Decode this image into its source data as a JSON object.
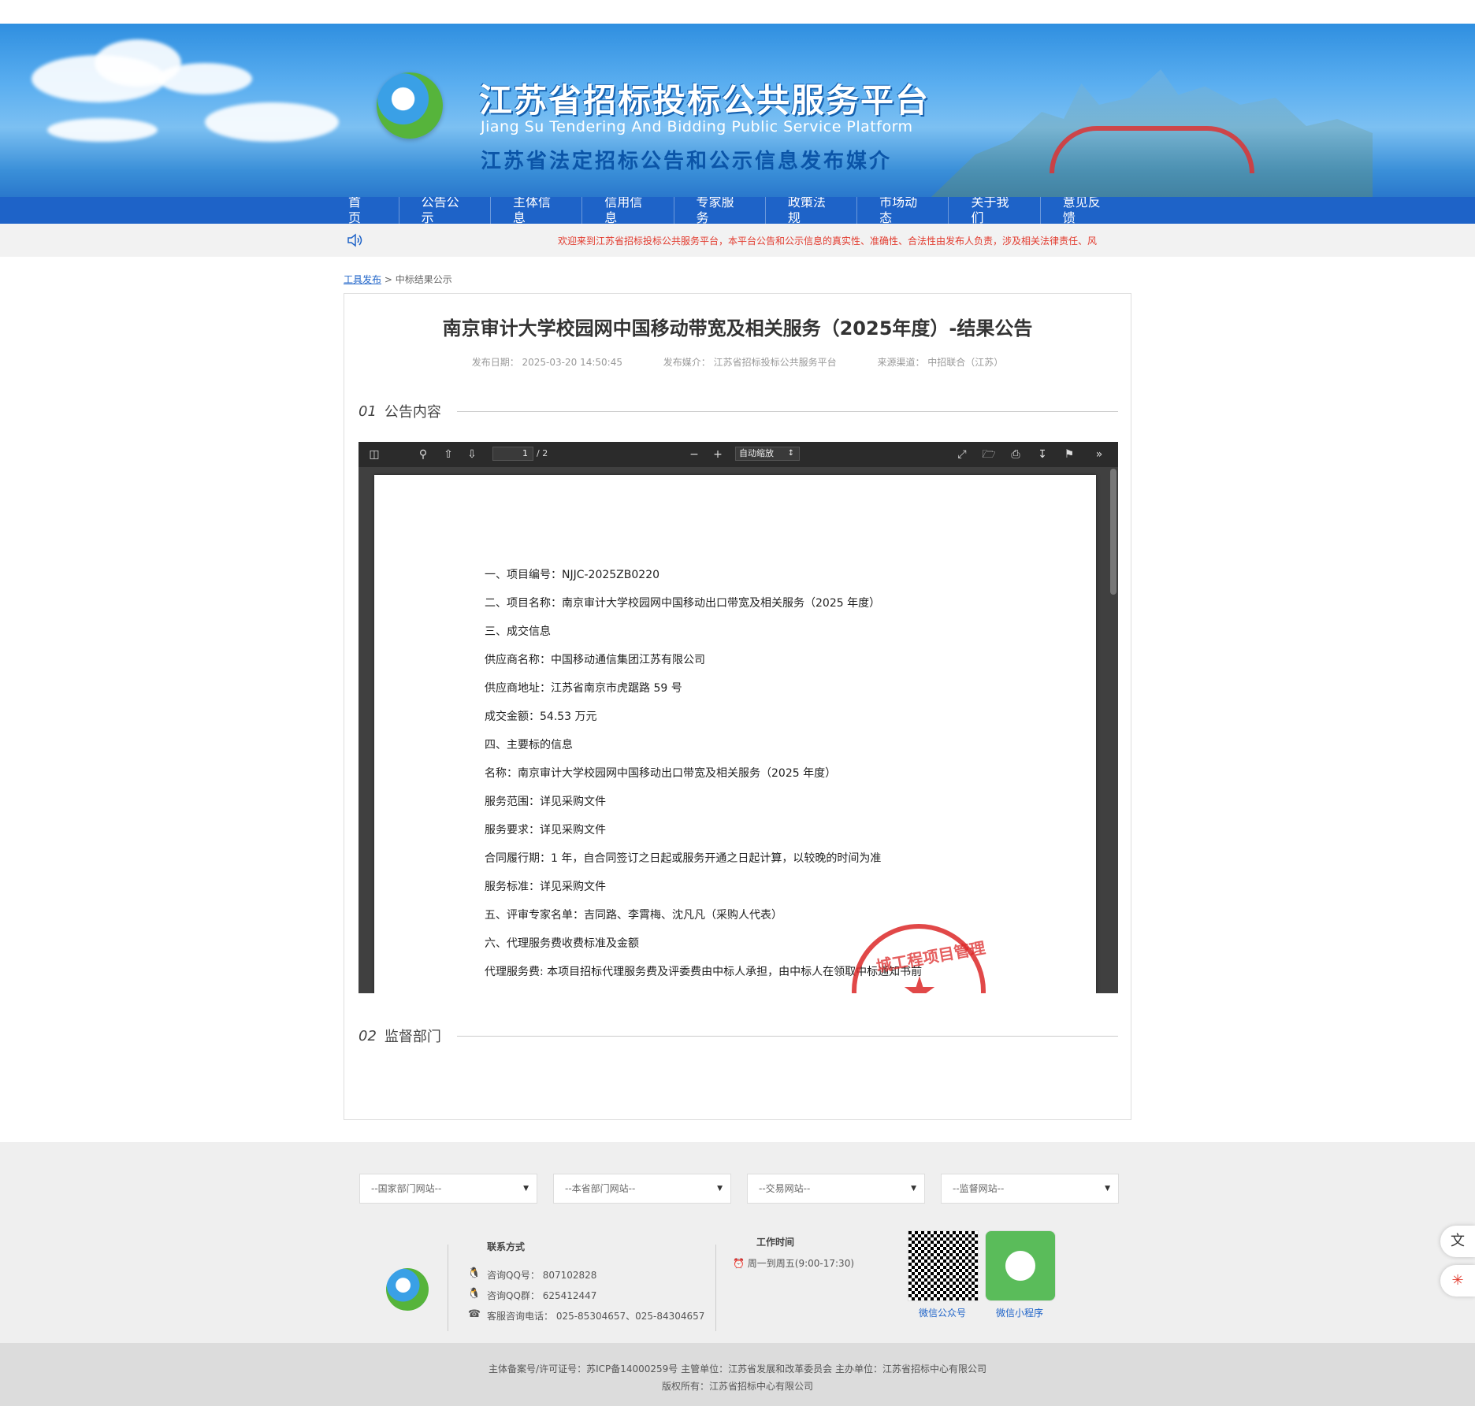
{
  "header": {
    "title_cn": "江苏省招标投标公共服务平台",
    "title_en": "Jiang Su Tendering And Bidding Public Service Platform",
    "subtitle": "江苏省法定招标公告和公示信息发布媒介"
  },
  "nav": [
    "首页",
    "公告公示",
    "主体信息",
    "信用信息",
    "专家服务",
    "政策法规",
    "市场动态",
    "关于我们",
    "意见反馈"
  ],
  "notice": {
    "icon": "speaker-icon",
    "text": "欢迎来到江苏省招标投标公共服务平台，本平台公告和公示信息的真实性、准确性、合法性由发布人负责，涉及相关法律责任、风"
  },
  "breadcrumb": {
    "link": "工具发布",
    "sep": ">",
    "current": "中标结果公示"
  },
  "article": {
    "title": "南京审计大学校园网中国移动带宽及相关服务（2025年度）-结果公告",
    "publish_date": "发布日期：  2025-03-20 14:50:45",
    "publish_media": "发布媒介：  江苏省招标投标公共服务平台",
    "source": "来源渠道：  中招联合（江苏）",
    "sections": [
      {
        "num": "01",
        "label": "公告内容"
      },
      {
        "num": "02",
        "label": "监督部门"
      }
    ]
  },
  "viewer": {
    "page_current": "1",
    "page_total": "/ 2",
    "zoom": "自动缩放",
    "lines": [
      "一、项目编号：NJJC-2025ZB0220",
      "二、项目名称：南京审计大学校园网中国移动出口带宽及相关服务（2025 年度）",
      "三、成交信息",
      "供应商名称：中国移动通信集团江苏有限公司",
      "供应商地址：江苏省南京市虎踞路 59 号",
      "成交金额：54.53 万元",
      "四、主要标的信息",
      "名称：南京审计大学校园网中国移动出口带宽及相关服务（2025 年度）",
      "服务范围：详见采购文件",
      "服务要求：详见采购文件",
      "合同履行期：1 年，自合同签订之日起或服务开通之日起计算，以较晚的时间为准",
      "服务标准：详见采购文件",
      "五、评审专家名单：吉同路、李霄梅、沈凡凡（采购人代表）",
      "六、代理服务费收费标准及金额",
      "代理服务费: 本项目招标代理服务费及评委费由中标人承担，由中标人在领取中标通知书前"
    ],
    "seal_text": "城工程项目管理"
  },
  "footer": {
    "selects": [
      "--国家部门网站--",
      "--本省部门网站--",
      "--交易网站--",
      "--监督网站--"
    ],
    "contact_title": "联系方式",
    "qq": "咨询QQ号：  807102828",
    "qq_group": "咨询QQ群：  625412447",
    "phone": "客服咨询电话：  025-85304657、025-84304657",
    "work_title": "工作时间",
    "work_hours": "周一到周五(9:00-17:30)",
    "qr1_label": "微信公众号",
    "qr2_label": "微信小程序"
  },
  "bottom": {
    "line1": "主体备案号/许可证号：苏ICP备14000259号 主管单位：江苏省发展和改革委员会 主办单位：江苏省招标中心有限公司",
    "line2": "版权所有：江苏省招标中心有限公司"
  },
  "side_buttons": [
    "translate-icon",
    "share-icon"
  ],
  "colors": {
    "nav": "#1e63c8",
    "notice_text": "#e23b2e",
    "link": "#1e63c8"
  }
}
